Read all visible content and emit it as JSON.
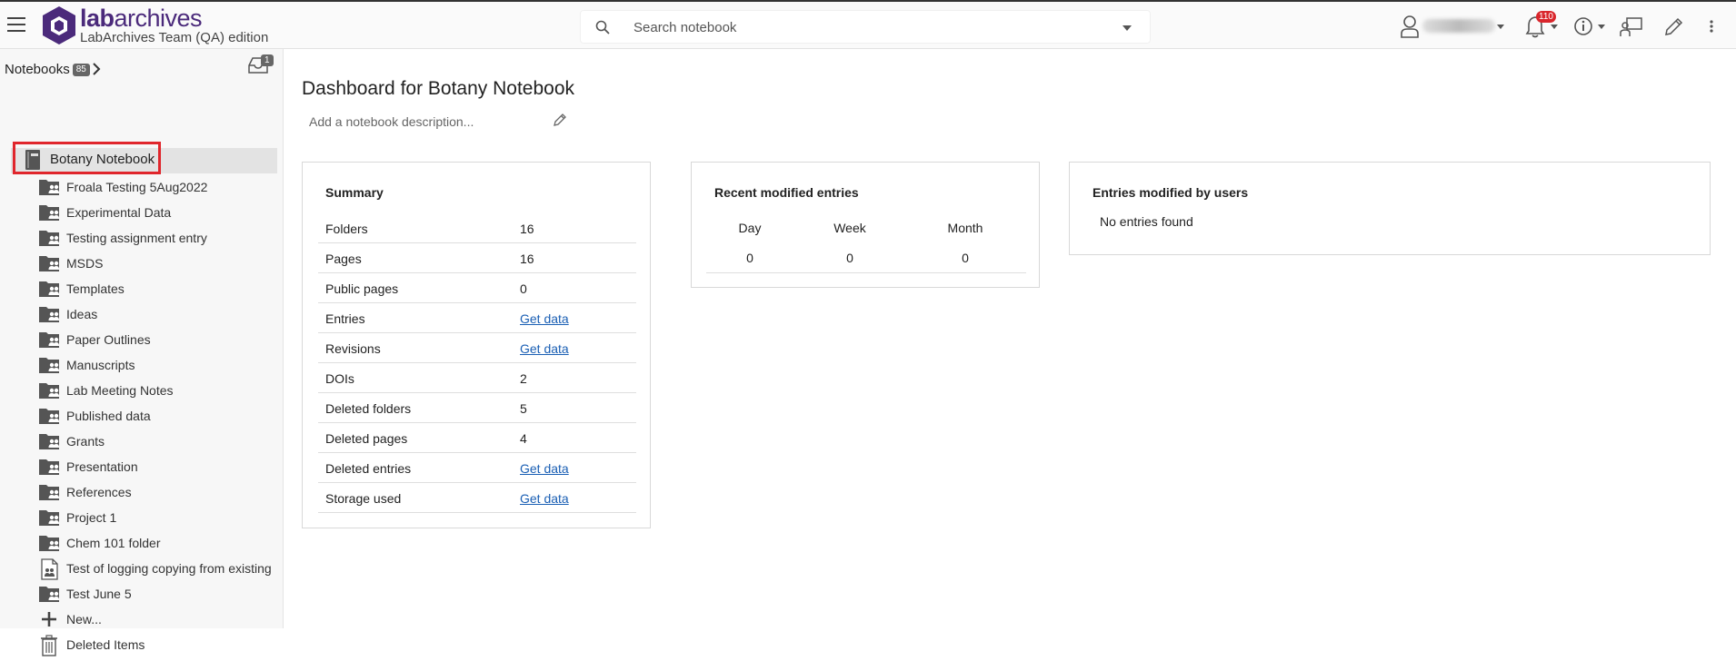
{
  "header": {
    "brand_lab": "lab",
    "brand_archives": "archives",
    "edition": "LabArchives Team (QA) edition",
    "search_placeholder": "Search notebook",
    "notification_count": "110"
  },
  "sidebar": {
    "notebooks_label": "Notebooks",
    "notebooks_count": "85",
    "inbox_count": "1",
    "active_notebook": "Botany Notebook",
    "items": [
      {
        "label": "Froala Testing 5Aug2022",
        "icon": "shared-folder-icon"
      },
      {
        "label": "Experimental Data",
        "icon": "shared-folder-icon"
      },
      {
        "label": "Testing assignment entry",
        "icon": "shared-folder-icon"
      },
      {
        "label": "MSDS",
        "icon": "shared-folder-icon"
      },
      {
        "label": "Templates",
        "icon": "shared-folder-icon"
      },
      {
        "label": "Ideas",
        "icon": "shared-folder-icon"
      },
      {
        "label": "Paper Outlines",
        "icon": "shared-folder-icon"
      },
      {
        "label": "Manuscripts",
        "icon": "shared-folder-icon"
      },
      {
        "label": "Lab Meeting Notes",
        "icon": "shared-folder-icon"
      },
      {
        "label": "Published data",
        "icon": "shared-folder-icon"
      },
      {
        "label": "Grants",
        "icon": "shared-folder-icon"
      },
      {
        "label": "Presentation",
        "icon": "shared-folder-icon"
      },
      {
        "label": "References",
        "icon": "shared-folder-icon"
      },
      {
        "label": "Project 1",
        "icon": "shared-folder-icon"
      },
      {
        "label": "Chem 101 folder",
        "icon": "shared-folder-icon"
      },
      {
        "label": "Test of logging copying from existing",
        "icon": "shared-page-icon"
      },
      {
        "label": "Test June 5",
        "icon": "shared-folder-icon"
      },
      {
        "label": "New...",
        "icon": "plus-icon"
      },
      {
        "label": "Deleted Items",
        "icon": "trash-icon"
      }
    ]
  },
  "main": {
    "title": "Dashboard for Botany Notebook",
    "description_placeholder": "Add a notebook description...",
    "summary": {
      "title": "Summary",
      "rows": [
        {
          "key": "Folders",
          "value": "16"
        },
        {
          "key": "Pages",
          "value": "16"
        },
        {
          "key": "Public pages",
          "value": "0"
        },
        {
          "key": "Entries",
          "value": "Get data"
        },
        {
          "key": "Revisions",
          "value": "Get data"
        },
        {
          "key": "DOIs",
          "value": "2"
        },
        {
          "key": "Deleted folders",
          "value": "5"
        },
        {
          "key": "Deleted pages",
          "value": "4"
        },
        {
          "key": "Deleted entries",
          "value": "Get data"
        },
        {
          "key": "Storage used",
          "value": "Get data"
        }
      ]
    },
    "recent": {
      "title": "Recent modified entries",
      "columns": [
        "Day",
        "Week",
        "Month"
      ],
      "values": [
        "0",
        "0",
        "0"
      ]
    },
    "users": {
      "title": "Entries modified by users",
      "empty": "No entries found"
    }
  },
  "colors": {
    "brand": "#4b2a7b",
    "link": "#1a5fb4",
    "highlight": "#e0262c"
  }
}
